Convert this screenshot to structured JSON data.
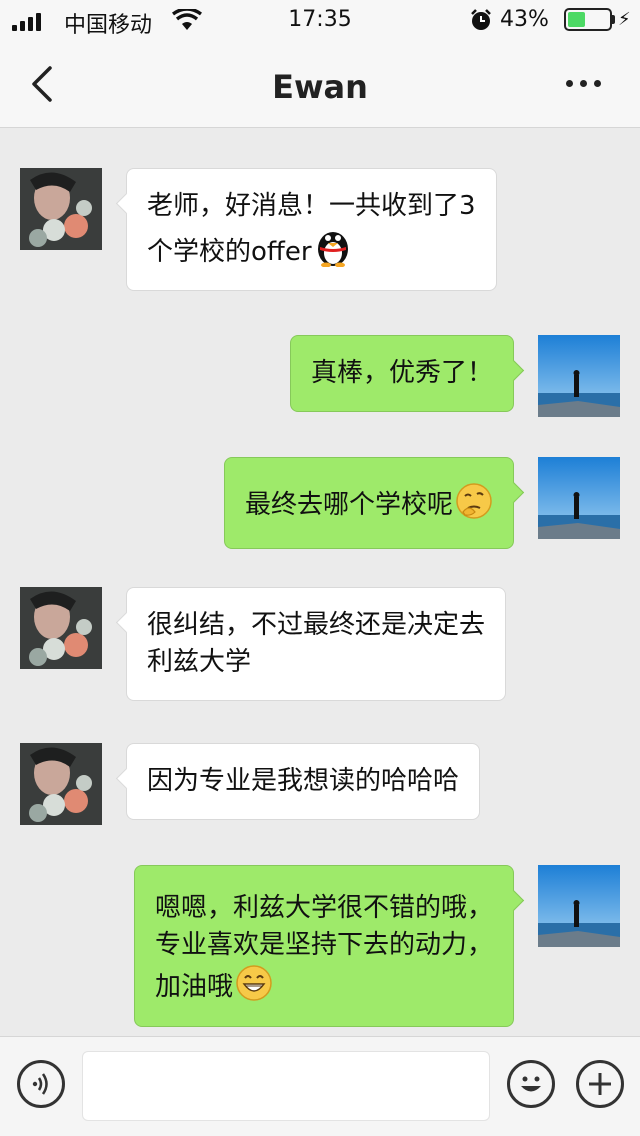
{
  "status_bar": {
    "carrier": "中国移动",
    "time": "17:35",
    "battery_percent": "43%",
    "battery_level": 0.43,
    "icons": [
      "signal-icon",
      "wifi-icon",
      "alarm-icon",
      "battery-icon",
      "charging-icon"
    ]
  },
  "header": {
    "title": "Ewan",
    "back_icon": "chevron-left-icon",
    "more_icon": "more-dots-icon"
  },
  "messages": [
    {
      "side": "left",
      "lines": [
        "老师，好消息！一共收到了3",
        "个学校的offer"
      ],
      "emoji": "penguin-icon"
    },
    {
      "side": "right",
      "lines": [
        "真棒，优秀了！"
      ]
    },
    {
      "side": "right",
      "lines": [
        "最终去哪个学校呢"
      ],
      "emoji": "thinking-face-icon"
    },
    {
      "side": "left",
      "lines": [
        "很纠结，不过最终还是决定去",
        "利兹大学"
      ]
    },
    {
      "side": "left",
      "lines": [
        "因为专业是我想读的哈哈哈"
      ]
    },
    {
      "side": "right",
      "lines": [
        "嗯嗯，利兹大学很不错的哦，",
        "专业喜欢是坚持下去的动力，",
        "加油哦"
      ],
      "emoji": "grin-icon"
    }
  ],
  "input_bar": {
    "placeholder": "",
    "icons": [
      "voice-icon",
      "emoji-icon",
      "plus-icon"
    ]
  },
  "colors": {
    "background": "#ebebeb",
    "bar_background": "#f7f7f7",
    "sent_bubble": "#9eea6a",
    "received_bubble": "#ffffff",
    "battery_fill": "#4cd964"
  }
}
